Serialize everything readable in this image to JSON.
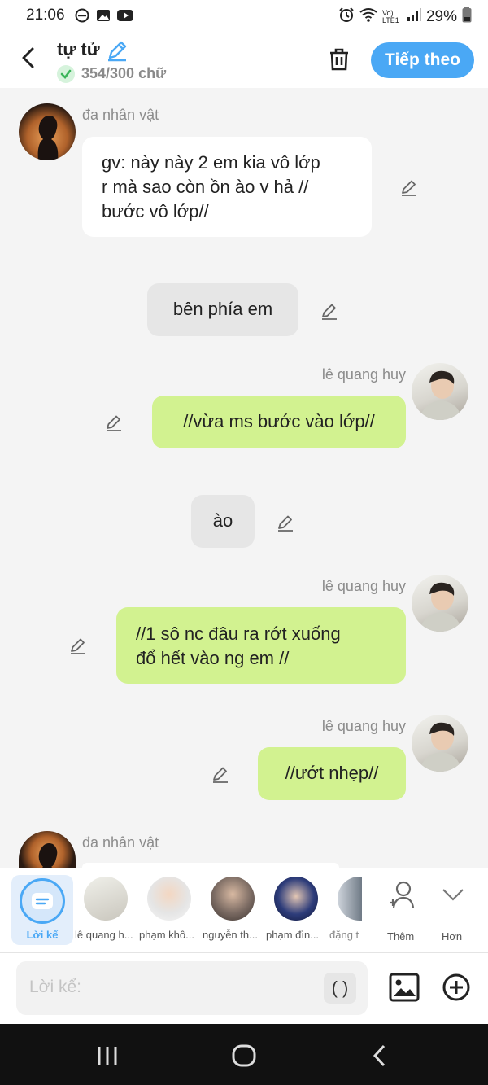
{
  "status_bar": {
    "time": "21:06",
    "battery": "29%",
    "network_label": "Vo) LTE1"
  },
  "header": {
    "title": "tự tử",
    "char_count": "354/300 chữ",
    "next_button": "Tiếp theo"
  },
  "messages": [
    {
      "type": "left",
      "name": "đa nhân vật",
      "text_lines": [
        "gv: này này 2 em kia vô lớp",
        "r mà sao còn ồn ào v hả //",
        "bước vô lớp//"
      ]
    },
    {
      "type": "narration",
      "text": "bên phía em"
    },
    {
      "type": "right",
      "name": "lê quang huy",
      "text": "//vừa ms bước vào lớp//"
    },
    {
      "type": "narration",
      "text": "ào"
    },
    {
      "type": "right",
      "name": "lê quang huy",
      "text_lines": [
        "//1 sô nc đâu ra rớt xuống",
        "đổ hết vào ng em //"
      ]
    },
    {
      "type": "right",
      "name": "lê quang huy",
      "text": "//ướt nhẹp//"
    },
    {
      "type": "left",
      "name": "đa nhân vật"
    }
  ],
  "character_bar": {
    "narration_label": "Lời kể",
    "characters": [
      "lê quang h...",
      "phạm khô...",
      "nguyễn th...",
      "phạm đìn...",
      "đặng t"
    ],
    "add_label": "Thêm",
    "more_label": "Hơn"
  },
  "input": {
    "placeholder": "Lời kể:",
    "paren_button": "( )"
  },
  "colors": {
    "accent": "#4aa8f5",
    "bubble_green": "#d2f290",
    "bubble_white": "#ffffff",
    "narration_gray": "#e6e6e6"
  },
  "icons": [
    "back-arrow-icon",
    "edit-pencil-icon",
    "check-icon",
    "trash-icon",
    "image-icon",
    "plus-circle-icon",
    "add-person-icon",
    "chevron-down-icon",
    "wifi-icon",
    "signal-icon",
    "battery-icon",
    "alarm-icon"
  ]
}
